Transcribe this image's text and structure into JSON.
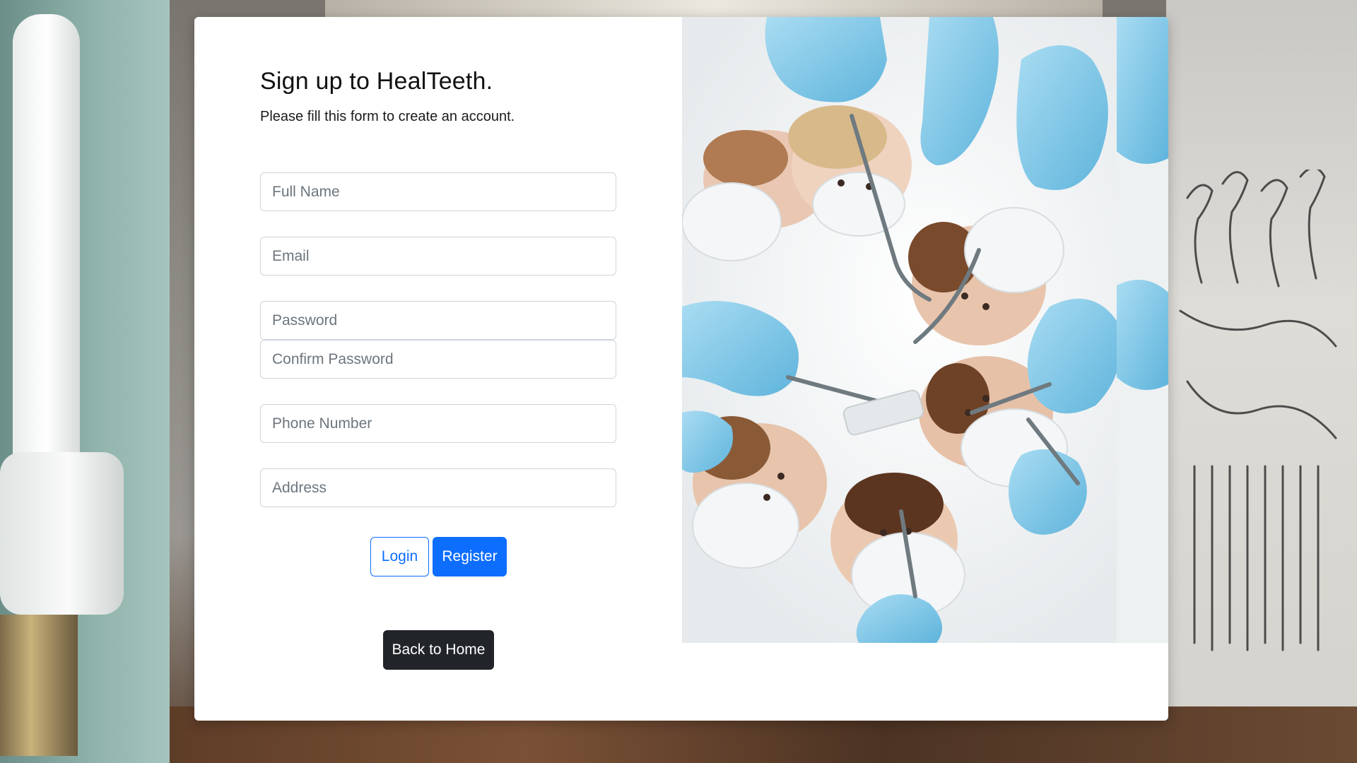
{
  "form": {
    "title": "Sign up to HealTeeth.",
    "subtitle": "Please fill this form to create an account.",
    "fields": {
      "full_name": {
        "placeholder": "Full Name",
        "value": ""
      },
      "email": {
        "placeholder": "Email",
        "value": ""
      },
      "password": {
        "placeholder": "Password",
        "value": ""
      },
      "confirm_password": {
        "placeholder": "Confirm Password",
        "value": ""
      },
      "phone": {
        "placeholder": "Phone Number",
        "value": ""
      },
      "address": {
        "placeholder": "Address",
        "value": ""
      }
    },
    "buttons": {
      "login": "Login",
      "register": "Register",
      "back_home": "Back to Home"
    }
  },
  "colors": {
    "primary": "#0d6efd",
    "dark": "#212529",
    "glove": "#7ec8e8",
    "mask": "#f2f4f5"
  },
  "illustration": "dentists-looking-down-photo"
}
